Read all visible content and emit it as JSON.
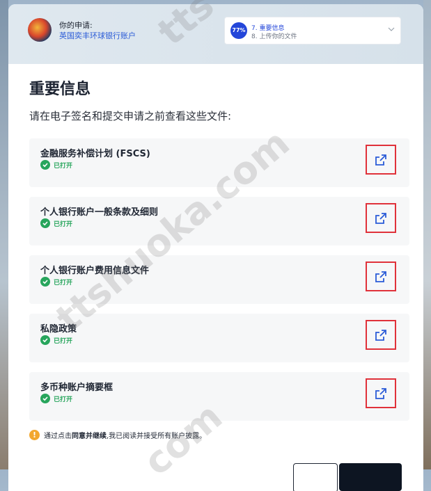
{
  "header": {
    "application_label": "你的申请:",
    "application_name": "英国奕丰环球银行账户",
    "progress_percent": "77%",
    "current_step": "7. 重要信息",
    "next_step": "8. 上传你的文件"
  },
  "page": {
    "title": "重要信息",
    "intro": "请在电子签名和提交申请之前查看这些文件:"
  },
  "documents": [
    {
      "title": "金融服务补偿计划 (FSCS)",
      "status": "已打开"
    },
    {
      "title": "个人银行账户一般条款及细则",
      "status": "已打开"
    },
    {
      "title": "个人银行账户费用信息文件",
      "status": "已打开"
    },
    {
      "title": "私隐政策",
      "status": "已打开"
    },
    {
      "title": "多币种账户摘要框",
      "status": "已打开"
    }
  ],
  "notice": {
    "prefix": "通过点击",
    "bold": "同意并继续",
    "suffix": ",我已阅读并接受所有账户披露。"
  },
  "watermark": {
    "text1": "ttshuoka.com",
    "text2": "tts",
    "text3": "com"
  },
  "colors": {
    "accent": "#2346d9",
    "success": "#27a55c",
    "highlight": "#e0313a",
    "warning": "#f2a72e"
  }
}
